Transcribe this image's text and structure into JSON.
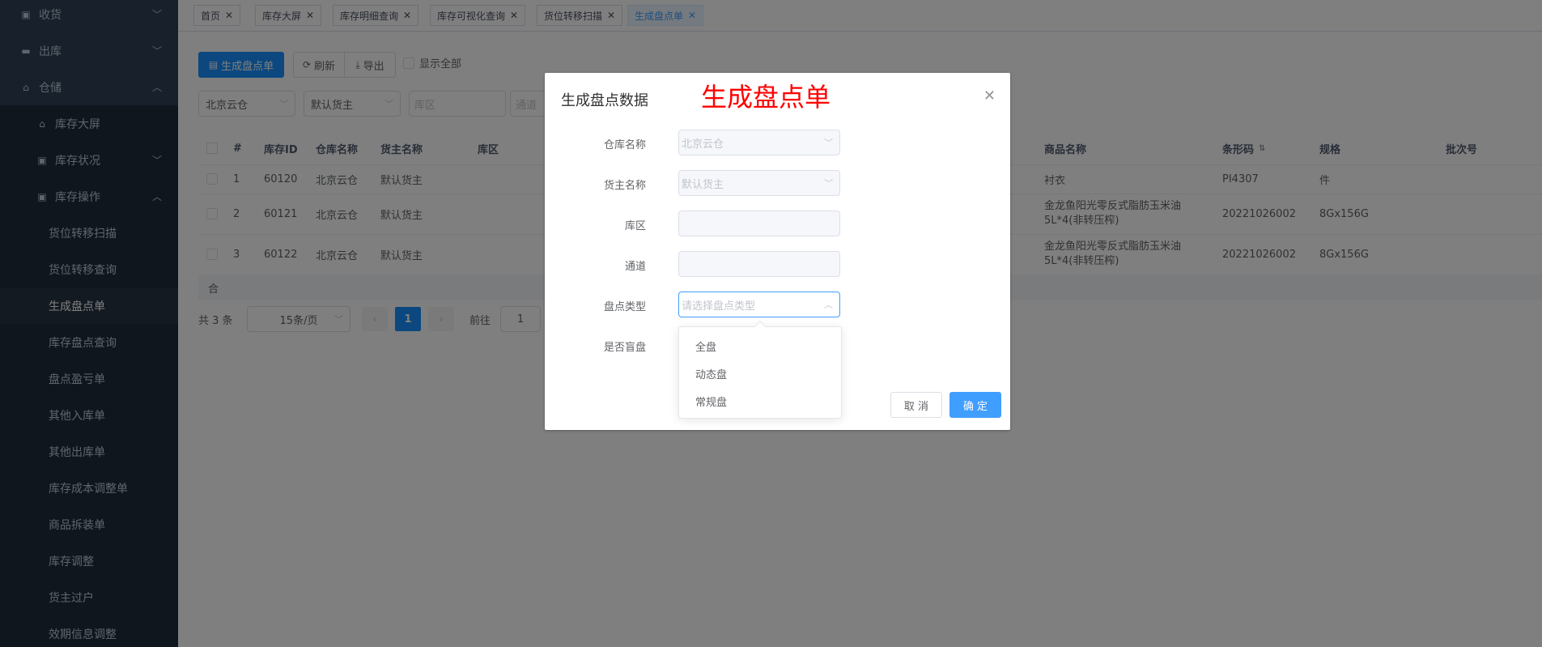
{
  "sidebar": {
    "items": [
      {
        "label": "收货",
        "icon": "receipt-icon"
      },
      {
        "label": "出库",
        "icon": "truck-icon"
      },
      {
        "label": "仓储",
        "icon": "home-icon"
      },
      {
        "label": "库存大屏",
        "icon": "home-icon"
      },
      {
        "label": "库存状况",
        "icon": "grid-icon"
      },
      {
        "label": "库存操作",
        "icon": "grid-icon"
      },
      {
        "label": "货位转移扫描"
      },
      {
        "label": "货位转移查询"
      },
      {
        "label": "生成盘点单"
      },
      {
        "label": "库存盘点查询"
      },
      {
        "label": "盘点盈亏单"
      },
      {
        "label": "其他入库单"
      },
      {
        "label": "其他出库单"
      },
      {
        "label": "库存成本调整单"
      },
      {
        "label": "商品拆装单"
      },
      {
        "label": "库存调整"
      },
      {
        "label": "货主过户"
      },
      {
        "label": "效期信息调整"
      }
    ]
  },
  "tabs": [
    {
      "label": "首页"
    },
    {
      "label": "库存大屏"
    },
    {
      "label": "库存明细查询"
    },
    {
      "label": "库存可视化查询"
    },
    {
      "label": "货位转移扫描"
    },
    {
      "label": "生成盘点单"
    }
  ],
  "toolbar": {
    "generate_label": "生成盘点单",
    "refresh_label": "刷新",
    "export_label": "导出",
    "show_all_label": "显示全部"
  },
  "filters": {
    "warehouse": "北京云仓",
    "owner": "默认货主",
    "zone_placeholder": "库区",
    "aisle_placeholder": "通道"
  },
  "table": {
    "headers": [
      "#",
      "库存ID",
      "仓库名称",
      "货主名称",
      "库区",
      "商品名称",
      "条形码",
      "规格",
      "批次号"
    ],
    "rows": [
      {
        "num": "1",
        "id": "60120",
        "warehouse": "北京云仓",
        "owner": "默认货主",
        "product": "衬衣",
        "barcode": "PI4307",
        "spec": "件"
      },
      {
        "num": "2",
        "id": "60121",
        "warehouse": "北京云仓",
        "owner": "默认货主",
        "product": "金龙鱼阳光零反式脂肪玉米油5L*4(非转压榨)",
        "barcode": "20221026002",
        "spec": "8Gx156G"
      },
      {
        "num": "3",
        "id": "60122",
        "warehouse": "北京云仓",
        "owner": "默认货主",
        "product": "金龙鱼阳光零反式脂肪玉米油5L*4(非转压榨)",
        "barcode": "20221026002",
        "spec": "8Gx156G"
      }
    ],
    "sum_label": "合"
  },
  "pagination": {
    "total": "共 3 条",
    "page_size": "15条/页",
    "current_page": "1",
    "goto_label": "前往",
    "goto_value": "1"
  },
  "dialog": {
    "title": "生成盘点数据",
    "annotation": "生成盘点单",
    "fields": {
      "warehouse_label": "仓库名称",
      "warehouse_value": "北京云仓",
      "owner_label": "货主名称",
      "owner_value": "默认货主",
      "zone_label": "库区",
      "aisle_label": "通道",
      "type_label": "盘点类型",
      "type_placeholder": "请选择盘点类型",
      "blind_label": "是否盲盘"
    },
    "dropdown_options": [
      "全盘",
      "动态盘",
      "常规盘"
    ],
    "cancel_label": "取 消",
    "ok_label": "确 定"
  },
  "colors": {
    "sidebar_bg": "#304156",
    "primary": "#1890ff",
    "annotation": "#ff0000"
  }
}
